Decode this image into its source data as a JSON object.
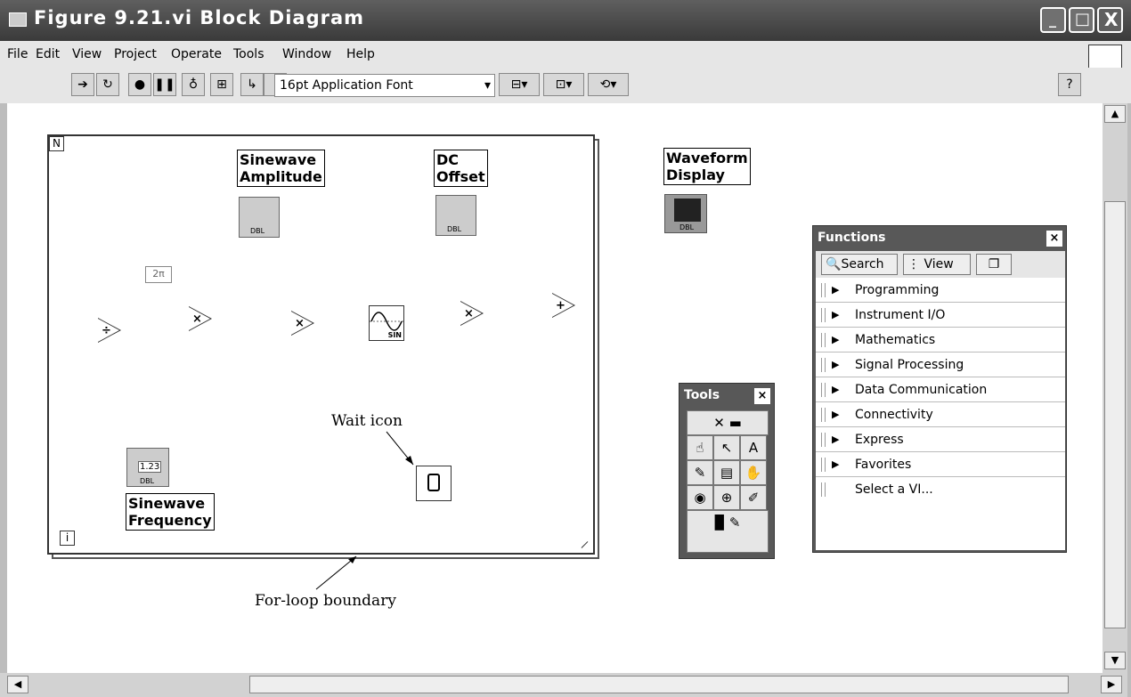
{
  "window": {
    "title": "Figure 9.21.vi Block Diagram",
    "min": "_",
    "max": "□",
    "close": "X"
  },
  "menu": [
    "File",
    "Edit",
    "View",
    "Project",
    "Operate",
    "Tools",
    "Window",
    "Help"
  ],
  "toolbar": {
    "font": "16pt Application Font",
    "help": "?"
  },
  "diagram": {
    "loop_count_terminal": "N",
    "loop_iteration_terminal": "i",
    "two_pi": "2π",
    "sine_amplitude_label": [
      "Sinewave",
      "Amplitude"
    ],
    "dc_offset_label": [
      "DC",
      "Offset"
    ],
    "waveform_label": [
      "Waveform",
      "Display"
    ],
    "frequency_label": [
      "Sinewave",
      "Frequency"
    ],
    "freq_value": "1.23",
    "dbl": "DBL",
    "sin": "SIN",
    "divide": "÷",
    "multiply": "×",
    "add": "+"
  },
  "annotations": {
    "wait": "Wait icon",
    "for_loop": "For-loop boundary"
  },
  "tools_palette": {
    "title": "Tools"
  },
  "functions_palette": {
    "title": "Functions",
    "search": "Search",
    "view": "View",
    "items": [
      "Programming",
      "Instrument I/O",
      "Mathematics",
      "Signal Processing",
      "Data Communication",
      "Connectivity",
      "Express",
      "Favorites",
      "Select a VI..."
    ]
  }
}
